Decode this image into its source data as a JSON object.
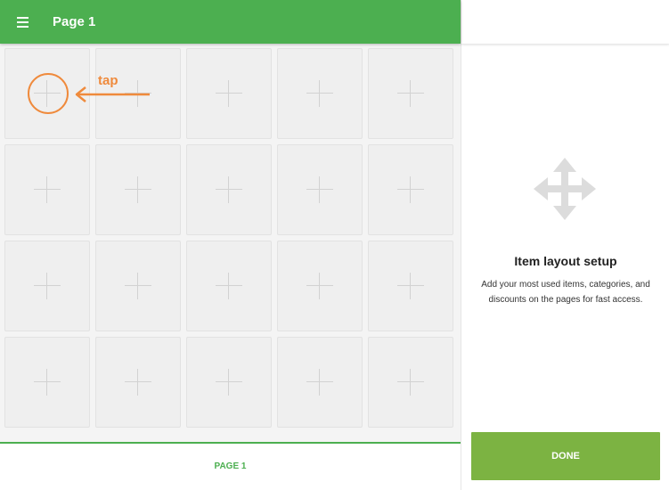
{
  "header": {
    "menu_icon": "hamburger-menu-icon",
    "title": "Page 1"
  },
  "grid": {
    "rows": 4,
    "columns": 5,
    "tile_icon": "plus-icon"
  },
  "annotation": {
    "label": "tap",
    "color": "#ef8a3c"
  },
  "bottom_bar": {
    "page_tab_label": "PAGE 1"
  },
  "setup_panel": {
    "icon": "move-arrows-icon",
    "title": "Item layout setup",
    "description": "Add your most used items, categories, and discounts on the pages for fast access.",
    "done_label": "DONE"
  },
  "colors": {
    "primary": "#4caf50",
    "done_button": "#7cb342",
    "accent": "#ef8a3c"
  }
}
